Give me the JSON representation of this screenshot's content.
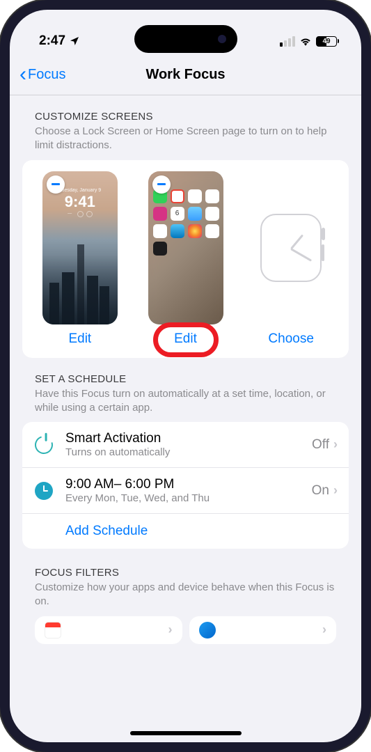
{
  "status": {
    "time": "2:47",
    "battery_pct": "49"
  },
  "nav": {
    "back_label": "Focus",
    "title": "Work Focus"
  },
  "customize": {
    "header": "CUSTOMIZE SCREENS",
    "desc": "Choose a Lock Screen or Home Screen page to turn on to help limit distractions.",
    "lock": {
      "day": "Tuesday, January 9",
      "time": "9:41",
      "action": "Edit"
    },
    "home": {
      "action": "Edit"
    },
    "watch": {
      "action": "Choose"
    }
  },
  "schedule": {
    "header": "SET A SCHEDULE",
    "desc": "Have this Focus turn on automatically at a set time, location, or while using a certain app.",
    "smart": {
      "title": "Smart Activation",
      "sub": "Turns on automatically",
      "state": "Off"
    },
    "time": {
      "title": "9:00 AM– 6:00 PM",
      "sub": "Every Mon, Tue, Wed, and Thu",
      "state": "On"
    },
    "add": "Add Schedule"
  },
  "filters": {
    "header": "FOCUS FILTERS",
    "desc": "Customize how your apps and device behave when this Focus is on."
  }
}
